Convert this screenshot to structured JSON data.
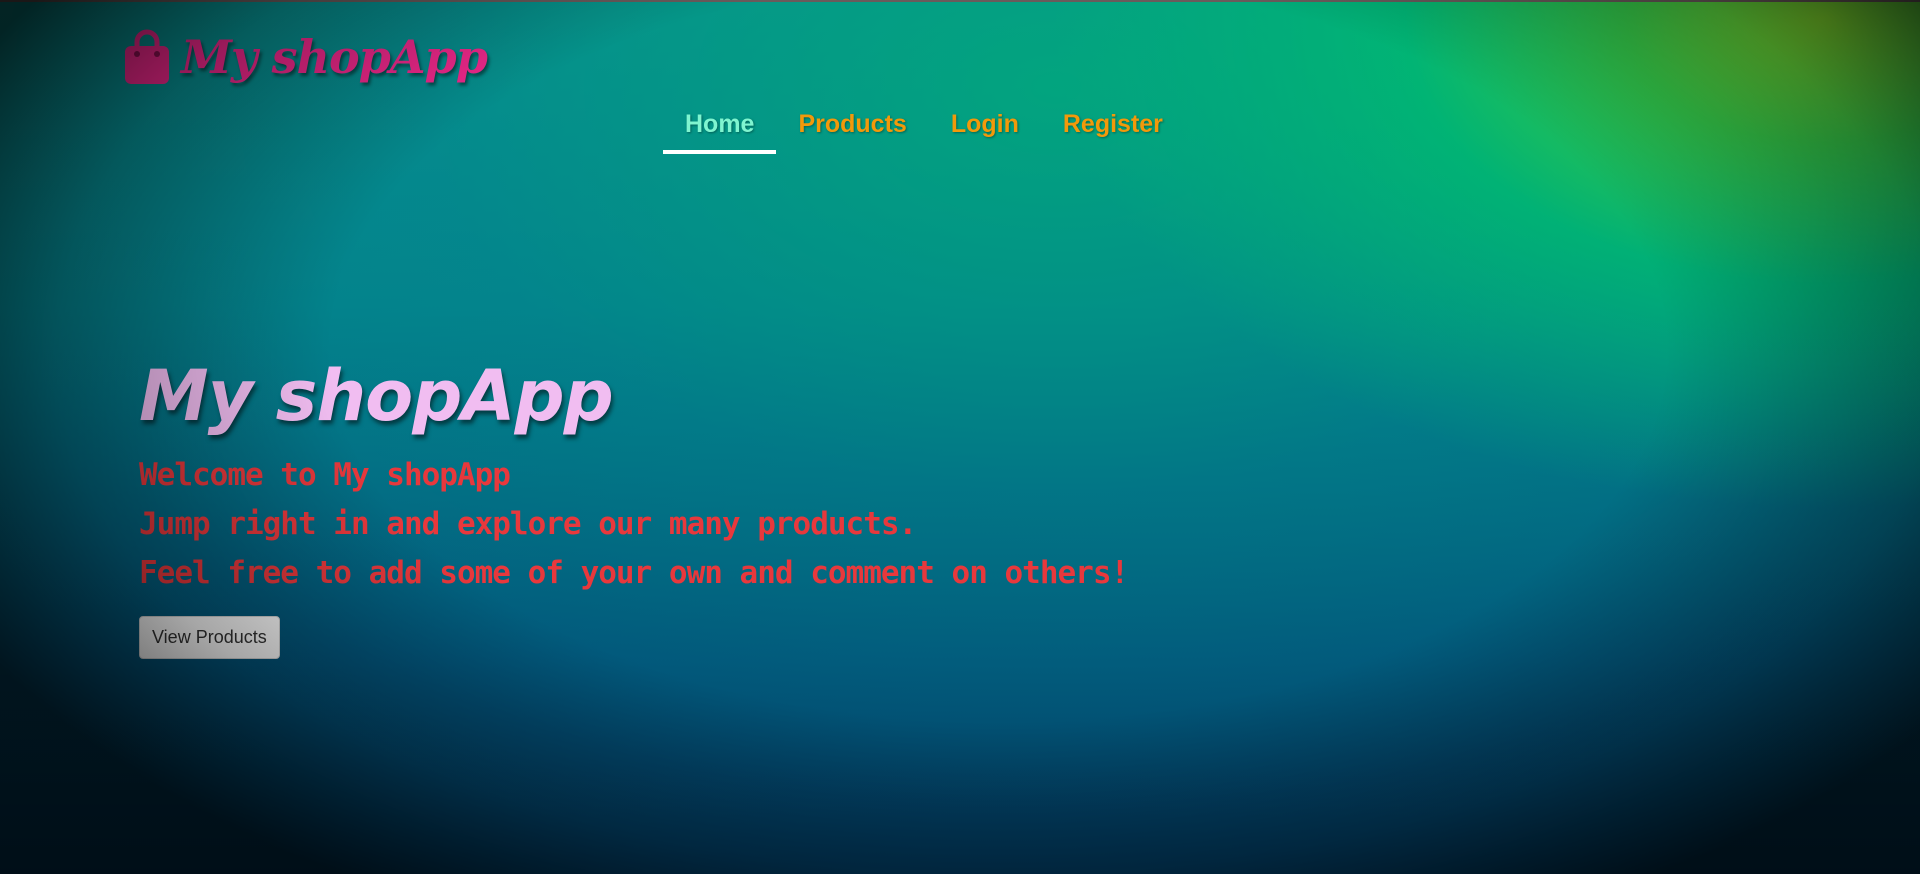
{
  "header": {
    "brand": "My shopApp",
    "brand_icon": "shopping-bag-icon",
    "brand_color": "#f0288c"
  },
  "nav": {
    "items": [
      {
        "label": "Home",
        "active": true
      },
      {
        "label": "Products",
        "active": false
      },
      {
        "label": "Login",
        "active": false
      },
      {
        "label": "Register",
        "active": false
      }
    ],
    "active_color": "#7ff5d0",
    "item_color": "#f2990a"
  },
  "hero": {
    "title": "My shopApp",
    "lines": [
      "Welcome to My shopApp",
      "Jump right in and explore our many products.",
      "Feel free to add some of your own and comment on others!"
    ],
    "button_label": "View Products",
    "title_color": "#f1bdf1",
    "text_color": "#e8383c"
  }
}
